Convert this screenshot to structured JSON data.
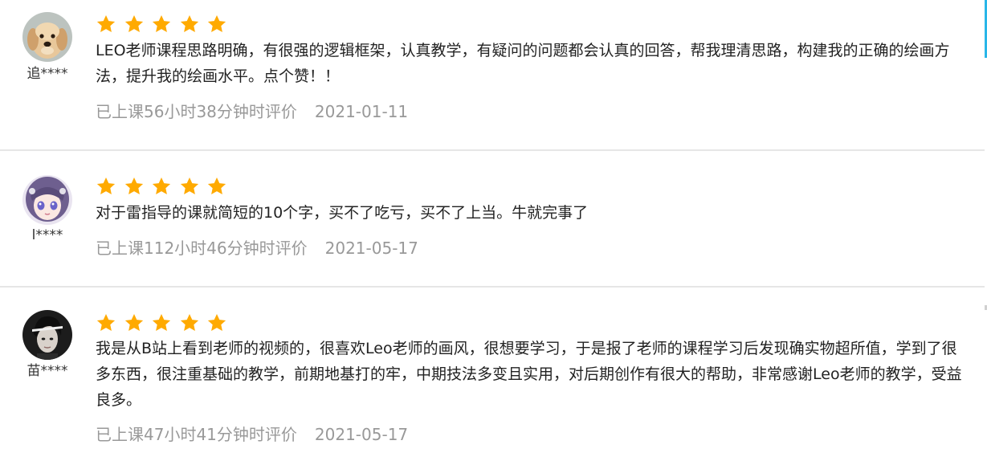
{
  "colors": {
    "star": "#FFAA00",
    "meta_text": "#999999",
    "divider": "#E6E6E6",
    "scroll_accent": "#29B6E8"
  },
  "reviews": [
    {
      "username": "追****",
      "avatar_icon": "puppy-avatar",
      "rating": 5,
      "comment": "LEO老师课程思路明确，有很强的逻辑框架，认真教学，有疑问的问题都会认真的回答，帮我理清思路，构建我的正确的绘画方法，提升我的绘画水平。点个赞！！",
      "study_time": "已上课56小时38分钟时评价",
      "date": "2021-01-11"
    },
    {
      "username": "l****",
      "avatar_icon": "anime-girl-avatar",
      "rating": 5,
      "comment": "对于雷指导的课就简短的10个字，买不了吃亏，买不了上当。牛就完事了",
      "study_time": "已上课112小时46分钟时评价",
      "date": "2021-05-17"
    },
    {
      "username": "苗****",
      "avatar_icon": "dark-portrait-avatar",
      "rating": 5,
      "comment": "我是从B站上看到老师的视频的，很喜欢Leo老师的画风，很想要学习，于是报了老师的课程学习后发现确实物超所值，学到了很多东西，很注重基础的教学，前期地基打的牢，中期技法多变且实用，对后期创作有很大的帮助，非常感谢Leo老师的教学，受益良多。",
      "study_time": "已上课47小时41分钟时评价",
      "date": "2021-05-17"
    }
  ]
}
